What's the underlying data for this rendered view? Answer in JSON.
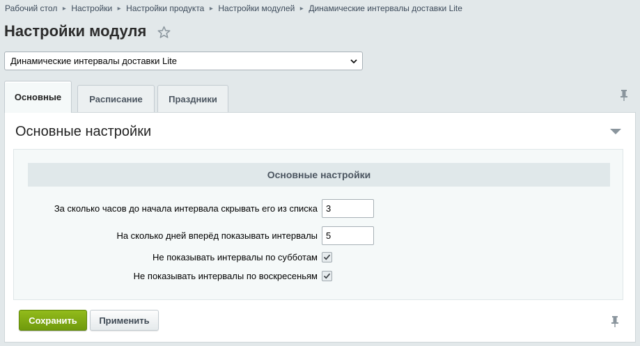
{
  "breadcrumb": [
    "Рабочий стол",
    "Настройки",
    "Настройки продукта",
    "Настройки модулей",
    "Динамические интервалы доставки Lite"
  ],
  "page_title": "Настройки модуля",
  "module_select": {
    "selected": "Динамические интервалы доставки Lite"
  },
  "tabs": [
    {
      "label": "Основные",
      "active": true
    },
    {
      "label": "Расписание",
      "active": false
    },
    {
      "label": "Праздники",
      "active": false
    }
  ],
  "section": {
    "heading": "Основные настройки",
    "form_header": "Основные настройки",
    "fields": {
      "hide_hours": {
        "label": "За сколько часов до начала интервала скрывать его из списка",
        "value": "3"
      },
      "show_days": {
        "label": "На сколько дней вперёд показывать интервалы",
        "value": "5"
      },
      "no_saturday": {
        "label": "Не показывать интервалы по субботам",
        "checked": true
      },
      "no_sunday": {
        "label": "Не показывать интервалы по воскресеньям",
        "checked": true
      }
    }
  },
  "buttons": {
    "save": "Сохранить",
    "apply": "Применить"
  },
  "icons": {
    "favorite": "star-icon",
    "pin": "pin-icon",
    "collapse": "triangle-down-icon",
    "separator": "chevron-right-icon"
  },
  "colors": {
    "save_button": "#7fa80f",
    "background": "#e2e8ea",
    "form_header_bg": "#e0e8ea"
  }
}
